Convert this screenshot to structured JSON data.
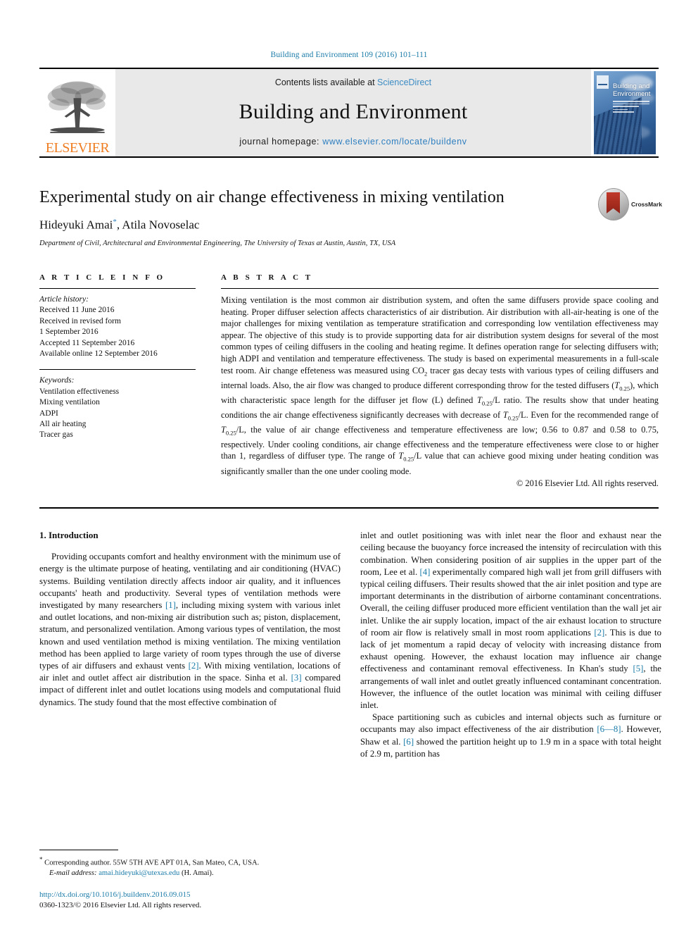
{
  "running_head": "Building and Environment 109 (2016) 101–111",
  "masthead": {
    "contents_prefix": "Contents lists available at ",
    "sciencedirect": "ScienceDirect",
    "journal_title": "Building and Environment",
    "homepage_prefix": "journal homepage: ",
    "homepage_url": "www.elsevier.com/locate/buildenv",
    "publisher": "ELSEVIER",
    "cover_title_line1": "Building and",
    "cover_title_line2": "Environment",
    "sciencedirect_color": "#3c8cc4",
    "link_color": "#2e7fc0",
    "elsevier_orange": "#ef7d22"
  },
  "article": {
    "title": "Experimental study on air change effectiveness in mixing ventilation",
    "authors": "Hideyuki Amai",
    "authors_rest": ", Atila Novoselac",
    "corresponding_marker": "*",
    "affiliation": "Department of Civil, Architectural and Environmental Engineering, The University of Texas at Austin, Austin, TX, USA",
    "crossmark_label": "CrossMark"
  },
  "info": {
    "heading": "A R T I C L E   I N F O",
    "history_label": "Article history:",
    "history": [
      "Received 11 June 2016",
      "Received in revised form",
      "1 September 2016",
      "Accepted 11 September 2016",
      "Available online 12 September 2016"
    ],
    "keywords_label": "Keywords:",
    "keywords": [
      "Ventilation effectiveness",
      "Mixing ventilation",
      "ADPI",
      "All air heating",
      "Tracer gas"
    ]
  },
  "abstract": {
    "heading": "A B S T R A C T",
    "p1_a": "Mixing ventilation is the most common air distribution system, and often the same diffusers provide space cooling and heating. Proper diffuser selection affects characteristics of air distribution. Air distribution with all-air-heating is one of the major challenges for mixing ventilation as temperature stratification and corresponding low ventilation effectiveness may appear. The objective of this study is to provide supporting data for air distribution system designs for several of the most common types of ceiling diffusers in the cooling and heating regime. It defines operation range for selecting diffusers with; high ADPI and ventilation and temperature effectiveness. The study is based on experimental measurements in a full-scale test room. Air change effeteness was measured using CO",
    "co2_sub": "2",
    "p1_b": " tracer gas decay tests with various types of ceiling diffusers and internal loads. Also, the air flow was changed to produce different corresponding throw for the tested diffusers (",
    "t025_1": "T",
    "t025_1_sub": "0.25",
    "p1_c": "), which with characteristic space length for the diffuser jet flow (L) defined ",
    "t025_2": "T",
    "t025_2_sub": "0.25",
    "p1_d": "/L ratio. The results show that under heating conditions the air change effectiveness significantly decreases with decrease of ",
    "t025_3": "T",
    "t025_3_sub": "0.25",
    "p1_e": "/L. Even for the recommended range of ",
    "t025_4": "T",
    "t025_4_sub": "0.25",
    "p1_f": "/L, the value of air change effectiveness and temperature effectiveness are low; 0.56 to 0.87 and 0.58 to 0.75, respectively. Under cooling conditions, air change effectiveness and the temperature effectiveness were close to or higher than 1, regardless of diffuser type. The range of ",
    "t025_5": "T",
    "t025_5_sub": "0.25",
    "p1_g": "/L value that can achieve good mixing under heating condition was significantly smaller than the one under cooling mode.",
    "copyright": "© 2016 Elsevier Ltd. All rights reserved."
  },
  "introduction": {
    "heading": "1. Introduction",
    "left_p1_a": "Providing occupants comfort and healthy environment with the minimum use of energy is the ultimate purpose of heating, ventilating and air conditioning (HVAC) systems. Building ventilation directly affects indoor air quality, and it influences occupants' heath and productivity. Several types of ventilation methods were investigated by many researchers ",
    "left_ref1": "[1]",
    "left_p1_b": ", including mixing system with various inlet and outlet locations, and non-mixing air distribution such as; piston, displacement, stratum, and personalized ventilation. Among various types of ventilation, the most known and used ventilation method is mixing ventilation. The mixing ventilation method has been applied to large variety of room types through the use of diverse types of air diffusers and exhaust vents ",
    "left_ref2": "[2]",
    "left_p1_c": ". With mixing ventilation, locations of air inlet and outlet affect air distribution in the space. Sinha et al. ",
    "left_ref3": "[3]",
    "left_p1_d": " compared impact of different inlet and outlet locations using models and computational fluid dynamics. The study found that the most effective combination of",
    "right_p1_a": "inlet and outlet positioning was with inlet near the floor and exhaust near the ceiling because the buoyancy force increased the intensity of recirculation with this combination. When considering position of air supplies in the upper part of the room, Lee et al. ",
    "right_ref4": "[4]",
    "right_p1_b": " experimentally compared high wall jet from grill diffusers with typical ceiling diffusers. Their results showed that the air inlet position and type are important determinants in the distribution of airborne contaminant concentrations. Overall, the ceiling diffuser produced more efficient ventilation than the wall jet air inlet. Unlike the air supply location, impact of the air exhaust location to structure of room air flow is relatively small in most room applications ",
    "right_ref2": "[2]",
    "right_p1_c": ". This is due to lack of jet momentum a rapid decay of velocity with increasing distance from exhaust opening. However, the exhaust location may influence air change effectiveness and contaminant removal effectiveness. In Khan's study ",
    "right_ref5": "[5]",
    "right_p1_d": ", the arrangements of wall inlet and outlet greatly influenced contaminant concentration. However, the influence of the outlet location was minimal with ceiling diffuser inlet.",
    "right_p2_a": "Space partitioning such as cubicles and internal objects such as furniture or occupants may also impact effectiveness of the air distribution ",
    "right_ref68": "[6—8]",
    "right_p2_b": ". However, Shaw et al. ",
    "right_ref6": "[6]",
    "right_p2_c": " showed the partition height up to 1.9 m in a space with total height of 2.9 m, partition has"
  },
  "footnote": {
    "star": "*",
    "corresponding": " Corresponding author. 55W 5TH AVE APT 01A, San Mateo, CA, USA.",
    "email_label": "E-mail address:",
    "email": "amai.hideyuki@utexas.edu",
    "email_suffix": " (H. Amai).",
    "doi": "http://dx.doi.org/10.1016/j.buildenv.2016.09.015",
    "issn": "0360-1323/© 2016 Elsevier Ltd. All rights reserved."
  }
}
